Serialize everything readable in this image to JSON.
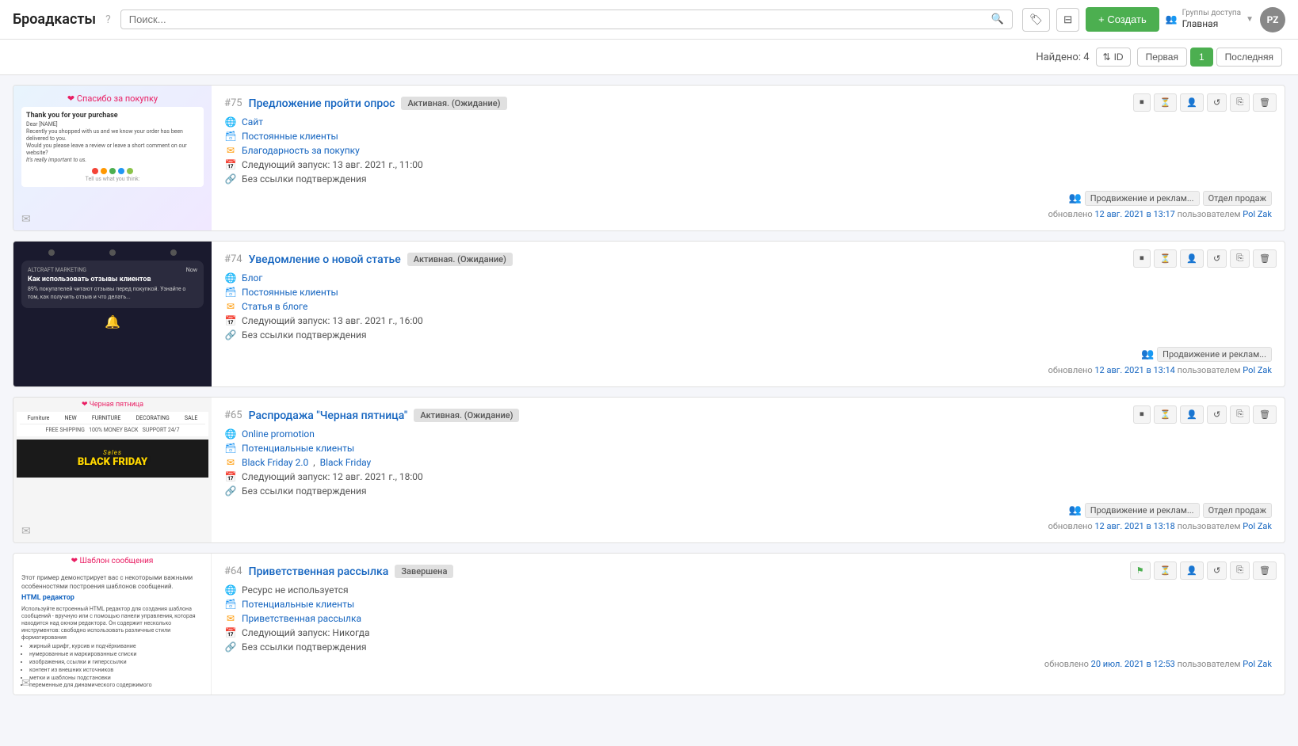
{
  "header": {
    "title": "Броадкасты",
    "help_tooltip": "?",
    "search_placeholder": "Поиск...",
    "search_icon": "🔍",
    "tags_icon": "🏷",
    "filter_icon": "⊟",
    "create_label": "+ Создать",
    "access_group_label": "Группы доступа",
    "access_group_value": "Главная",
    "avatar_initials": "PZ"
  },
  "pagination": {
    "found_label": "Найдено: 4",
    "sort_icon": "⇅",
    "sort_field": "ID",
    "first_label": "Первая",
    "page_number": "1",
    "last_label": "Последняя"
  },
  "broadcasts": [
    {
      "id": "#75",
      "title": "Предложение пройти опрос",
      "status": "Активная. (Ожидание)",
      "status_type": "active",
      "site": "Сайт",
      "segment": "Постоянные клиенты",
      "template": "Благодарность за покупку",
      "next_launch": "Следующий запуск: 13 авг. 2021 г., 11:00",
      "confirmation": "Без ссылки подтверждения",
      "groups": [
        "Продвижение и реклам...",
        "Отдел продаж"
      ],
      "updated": "обновлено",
      "updated_date": "12 авг. 2021 в 13:17",
      "updated_by": "пользователем",
      "updated_user": "Pol Zak",
      "preview_type": "1"
    },
    {
      "id": "#74",
      "title": "Уведомление о новой статье",
      "status": "Активная. (Ожидание)",
      "status_type": "active",
      "site": "Блог",
      "segment": "Постоянные клиенты",
      "template": "Статья в блоге",
      "next_launch": "Следующий запуск: 13 авг. 2021 г., 16:00",
      "confirmation": "Без ссылки подтверждения",
      "groups": [
        "Продвижение и реклам..."
      ],
      "updated": "обновлено",
      "updated_date": "12 авг. 2021 в 13:14",
      "updated_by": "пользователем",
      "updated_user": "Pol Zak",
      "preview_type": "2"
    },
    {
      "id": "#65",
      "title": "Распродажа \"Черная пятница\"",
      "status": "Активная. (Ожидание)",
      "status_type": "active",
      "site": "Online promotion",
      "segment": "Потенциальные клиенты",
      "template_1": "Black Friday 2.0",
      "template_2": "Black Friday",
      "next_launch": "Следующий запуск: 12 авг. 2021 г., 18:00",
      "confirmation": "Без ссылки подтверждения",
      "groups": [
        "Продвижение и реклам...",
        "Отдел продаж"
      ],
      "updated": "обновлено",
      "updated_date": "12 авг. 2021 в 13:18",
      "updated_by": "пользователем",
      "updated_user": "Pol Zak",
      "preview_type": "3"
    },
    {
      "id": "#64",
      "title": "Приветственная рассылка",
      "status": "Завершена",
      "status_type": "completed",
      "site": "Ресурс не используется",
      "segment": "Потенциальные клиенты",
      "template": "Приветственная рассылка",
      "next_launch": "Следующий запуск: Никогда",
      "confirmation": "Без ссылки подтверждения",
      "groups": [],
      "updated": "обновлено",
      "updated_date": "20 июл. 2021 в 12:53",
      "updated_by": "пользователем",
      "updated_user": "Pol Zak",
      "preview_type": "4"
    }
  ],
  "action_buttons": {
    "pause": "⏹",
    "timer": "⏳",
    "user": "👤",
    "history": "↺",
    "copy": "⎘",
    "delete": "🗑"
  }
}
